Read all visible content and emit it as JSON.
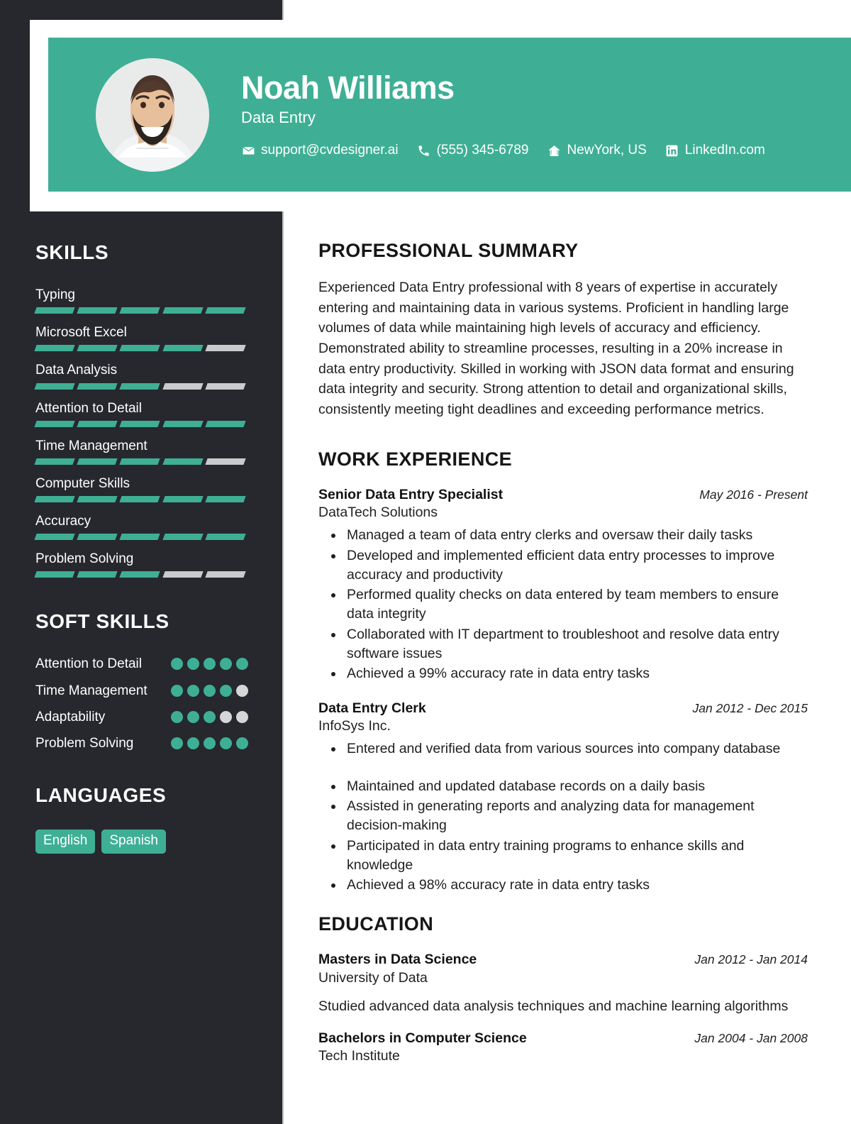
{
  "header": {
    "name": "Noah Williams",
    "job_title": "Data Entry",
    "avatar_alt": "avatar-photo",
    "contacts": [
      {
        "icon": "envelope-icon",
        "label": "support@cvdesigner.ai"
      },
      {
        "icon": "phone-icon",
        "label": "(555) 345-6789"
      },
      {
        "icon": "home-icon",
        "label": "NewYork, US"
      },
      {
        "icon": "linkedin-icon",
        "label": "LinkedIn.com"
      }
    ]
  },
  "colors": {
    "accent": "#3EAF95",
    "sidebar": "#26282E",
    "inactive": "#C8CACC",
    "text": "#1f1f1f"
  },
  "sidebar": {
    "skills_heading": "SKILLS",
    "skills": [
      {
        "label": "Typing",
        "filled": 5,
        "total": 5
      },
      {
        "label": "Microsoft Excel",
        "filled": 4,
        "total": 5
      },
      {
        "label": "Data Analysis",
        "filled": 3,
        "total": 5
      },
      {
        "label": "Attention to Detail",
        "filled": 5,
        "total": 5
      },
      {
        "label": "Time Management",
        "filled": 4,
        "total": 5
      },
      {
        "label": "Computer Skills",
        "filled": 5,
        "total": 5
      },
      {
        "label": "Accuracy",
        "filled": 5,
        "total": 5
      },
      {
        "label": "Problem Solving",
        "filled": 3,
        "total": 5
      }
    ],
    "soft_skills_heading": "SOFT SKILLS",
    "soft_skills": [
      {
        "label": "Attention to Detail",
        "filled": 5,
        "total": 5
      },
      {
        "label": "Time Management",
        "filled": 4,
        "total": 5
      },
      {
        "label": "Adaptability",
        "filled": 3,
        "total": 5
      },
      {
        "label": "Problem Solving",
        "filled": 5,
        "total": 5
      }
    ],
    "languages_heading": "LANGUAGES",
    "languages": [
      "English",
      "Spanish"
    ]
  },
  "main": {
    "summary_heading": "PROFESSIONAL SUMMARY",
    "summary": "Experienced Data Entry professional with 8 years of expertise in accurately entering and maintaining data in various systems. Proficient in handling large volumes of data while maintaining high levels of accuracy and efficiency. Demonstrated ability to streamline processes, resulting in a 20% increase in data entry productivity. Skilled in working with JSON data format and ensuring data integrity and security. Strong attention to detail and organizational skills, consistently meeting tight deadlines and exceeding performance metrics.",
    "work_heading": "WORK EXPERIENCE",
    "work": [
      {
        "role": "Senior Data Entry Specialist",
        "org": "DataTech Solutions",
        "date": "May 2016 - Present",
        "bullets": [
          "Managed a team of data entry clerks and oversaw their daily tasks",
          "Developed and implemented efficient data entry processes to improve accuracy and productivity",
          "Performed quality checks on data entered by team members to ensure data integrity",
          "Collaborated with IT department to troubleshoot and resolve data entry software issues",
          "Achieved a 99% accuracy rate in data entry tasks"
        ]
      },
      {
        "role": "Data Entry Clerk",
        "org": "InfoSys Inc.",
        "date": "Jan 2012 - Dec 2015",
        "bullets": [
          "Entered and verified data from various sources into company database",
          "Maintained and updated database records on a daily basis",
          "Assisted in generating reports and analyzing data for management decision-making",
          "Participated in data entry training programs to enhance skills and knowledge",
          "Achieved a 98% accuracy rate in data entry tasks"
        ]
      }
    ],
    "education_heading": "EDUCATION",
    "education": [
      {
        "degree": "Masters in Data Science",
        "school": "University of Data",
        "date": "Jan 2012 - Jan 2014",
        "description": "Studied advanced data analysis techniques and machine learning algorithms"
      },
      {
        "degree": "Bachelors in Computer Science",
        "school": "Tech Institute",
        "date": "Jan 2004 - Jan 2008",
        "description": ""
      }
    ]
  }
}
